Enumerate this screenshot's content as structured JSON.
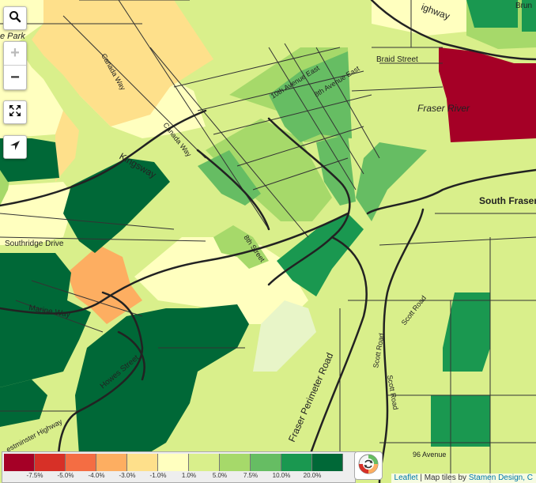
{
  "map": {
    "labels": {
      "park_fragment": "e Park",
      "canada_way_upper": "Canada Way",
      "canada_way_lower": "Canada Way",
      "kingsway": "Kingsway",
      "tenth_avenue_east": "10th Avenue East",
      "eighth_avenue_east": "8th Avenue East",
      "eighth_street": "8th Street",
      "braid_street": "Braid Street",
      "fraser_river": "Fraser River",
      "highway_fragment": "ighway",
      "brun_fragment": "Brun",
      "south_fraser": "South Fraser",
      "southridge_drive": "Southridge Drive",
      "marine_way": "Marine Way",
      "howes_street": "Howes Street",
      "westminster_highway": "estminster Highway",
      "fraser_perimeter_road": "Fraser Perimeter Road",
      "scott_road_upper": "Scott Road",
      "scott_road_lower": "Scott Road",
      "scott_road_diag": "Scott Road",
      "ninety_sixth_avenue": "96 Avenue"
    }
  },
  "controls": {
    "search_icon": "search-icon",
    "zoom_in_label": "+",
    "zoom_out_label": "−",
    "fullscreen_icon": "fullscreen-icon",
    "locate_icon": "locate-arrow-icon"
  },
  "legend": {
    "colors": [
      "#a50026",
      "#d73027",
      "#f46d43",
      "#fdae61",
      "#fee08b",
      "#ffffbf",
      "#d9ef8b",
      "#a6d96a",
      "#66bd63",
      "#1a9850",
      "#006837"
    ],
    "labels": [
      "-7.5%",
      "-5.0%",
      "-4.0%",
      "-3.0%",
      "-1.0%",
      "1.0%",
      "5.0%",
      "7.5%",
      "10.0%",
      "20.0%"
    ],
    "refresh_icon": "refresh-icon"
  },
  "attribution": {
    "leaflet": "Leaflet",
    "separator": " | Map tiles by ",
    "stamen": "Stamen Design, C"
  }
}
